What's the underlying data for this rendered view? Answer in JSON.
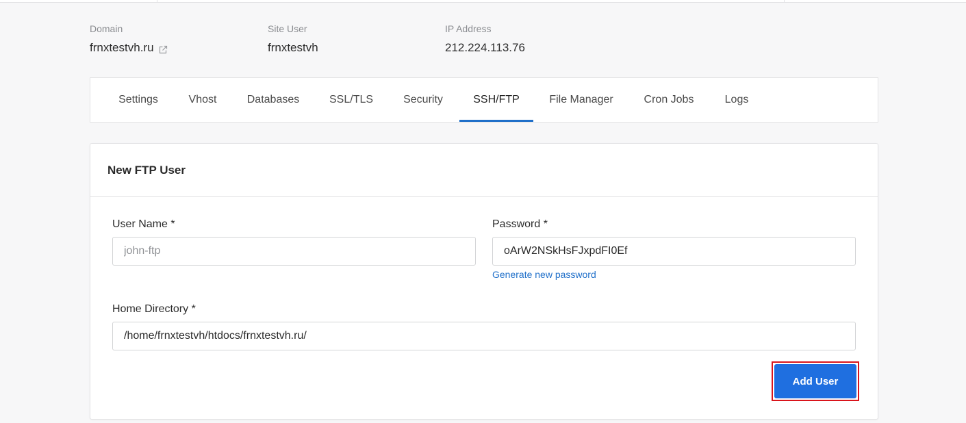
{
  "site_info": {
    "domain": {
      "label": "Domain",
      "value": "frnxtestvh.ru",
      "icon": "external-link-icon"
    },
    "site_user": {
      "label": "Site User",
      "value": "frnxtestvh"
    },
    "ip_address": {
      "label": "IP Address",
      "value": "212.224.113.76"
    }
  },
  "tabs": [
    {
      "label": "Settings"
    },
    {
      "label": "Vhost"
    },
    {
      "label": "Databases"
    },
    {
      "label": "SSL/TLS"
    },
    {
      "label": "Security"
    },
    {
      "label": "SSH/FTP",
      "active": true
    },
    {
      "label": "File Manager"
    },
    {
      "label": "Cron Jobs"
    },
    {
      "label": "Logs"
    }
  ],
  "form": {
    "title": "New FTP User",
    "user_name": {
      "label": "User Name *",
      "value": "",
      "placeholder": "john-ftp"
    },
    "password": {
      "label": "Password *",
      "value": "oArW2NSkHsFJxpdFI0Ef",
      "generate_link": "Generate new password"
    },
    "home_directory": {
      "label": "Home Directory *",
      "value": "/home/frnxtestvh/htdocs/frnxtestvh.ru/"
    },
    "submit_label": "Add User"
  },
  "colors": {
    "accent": "#1f6fc9",
    "button": "#1f6fe0",
    "highlight_border": "#d9141b"
  }
}
